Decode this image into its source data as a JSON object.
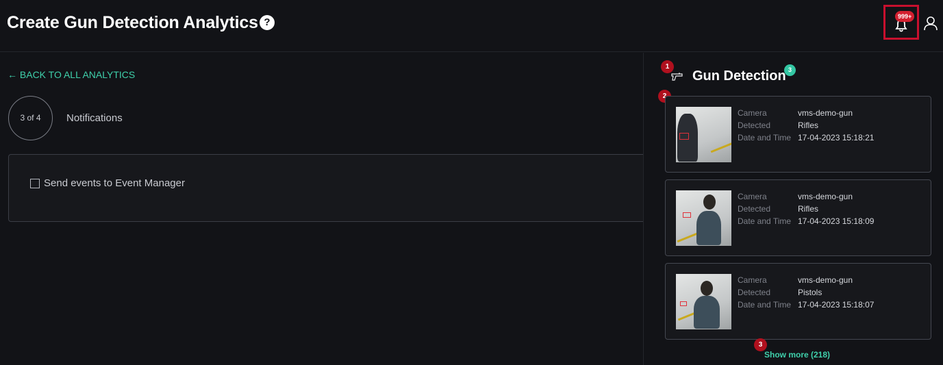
{
  "header": {
    "title": "Create Gun Detection Analytics",
    "help_glyph": "?",
    "notification_badge": "999+"
  },
  "main": {
    "back_link": "← BACK TO ALL ANALYTICS",
    "step": {
      "label": "3 of 4",
      "title": "Notifications"
    },
    "checkbox": {
      "label": "Send events to Event Manager",
      "checked": false
    }
  },
  "panel": {
    "title": "Gun Detection",
    "markers": {
      "title": "1",
      "list": "2",
      "show_more": "3",
      "count": "3"
    },
    "labels": {
      "camera": "Camera",
      "detected": "Detected",
      "datetime": "Date and Time"
    },
    "events": [
      {
        "camera": "vms-demo-gun",
        "detected": "Rifles",
        "datetime": "17-04-2023 15:18:21"
      },
      {
        "camera": "vms-demo-gun",
        "detected": "Rifles",
        "datetime": "17-04-2023 15:18:09"
      },
      {
        "camera": "vms-demo-gun",
        "detected": "Pistols",
        "datetime": "17-04-2023 15:18:07"
      }
    ],
    "show_more": "Show more (218)"
  },
  "colors": {
    "background": "#121317",
    "accent": "#3fd0ab",
    "alert": "#c8102e",
    "card_border": "#454851"
  },
  "icons": [
    "help-icon",
    "bell-icon",
    "user-icon",
    "gun-icon",
    "back-arrow-icon"
  ]
}
